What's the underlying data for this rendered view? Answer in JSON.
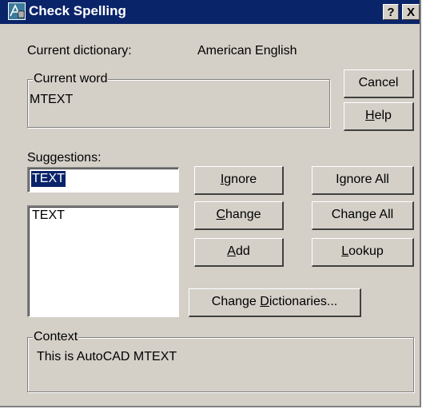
{
  "title": "Check Spelling",
  "title_buttons": {
    "help": "?",
    "close": "X"
  },
  "dictionary": {
    "label": "Current dictionary:",
    "value": "American English"
  },
  "current_word": {
    "legend": "Current word",
    "value": "MTEXT"
  },
  "suggestions": {
    "label": "Suggestions:",
    "input_value": "TEXT",
    "list": [
      "TEXT"
    ]
  },
  "buttons": {
    "cancel": "Cancel",
    "help": {
      "pre": "",
      "key": "H",
      "post": "elp"
    },
    "ignore": {
      "pre": "",
      "key": "I",
      "post": "gnore"
    },
    "ignore_all": {
      "pre": "I",
      "key": "g",
      "post": "nore All"
    },
    "change": {
      "pre": "",
      "key": "C",
      "post": "hange"
    },
    "change_all": {
      "pre": "Chan",
      "key": "g",
      "post": "e All"
    },
    "add": {
      "pre": "",
      "key": "A",
      "post": "dd"
    },
    "lookup": {
      "pre": "",
      "key": "L",
      "post": "ookup"
    },
    "change_dictionaries": {
      "pre": "Change ",
      "key": "D",
      "post": "ictionaries..."
    }
  },
  "context": {
    "legend": "Context",
    "value": "This is AutoCAD MTEXT"
  },
  "colors": {
    "titlebar": "#0a246a",
    "face": "#d4d0c8",
    "selection": "#0a246a"
  }
}
